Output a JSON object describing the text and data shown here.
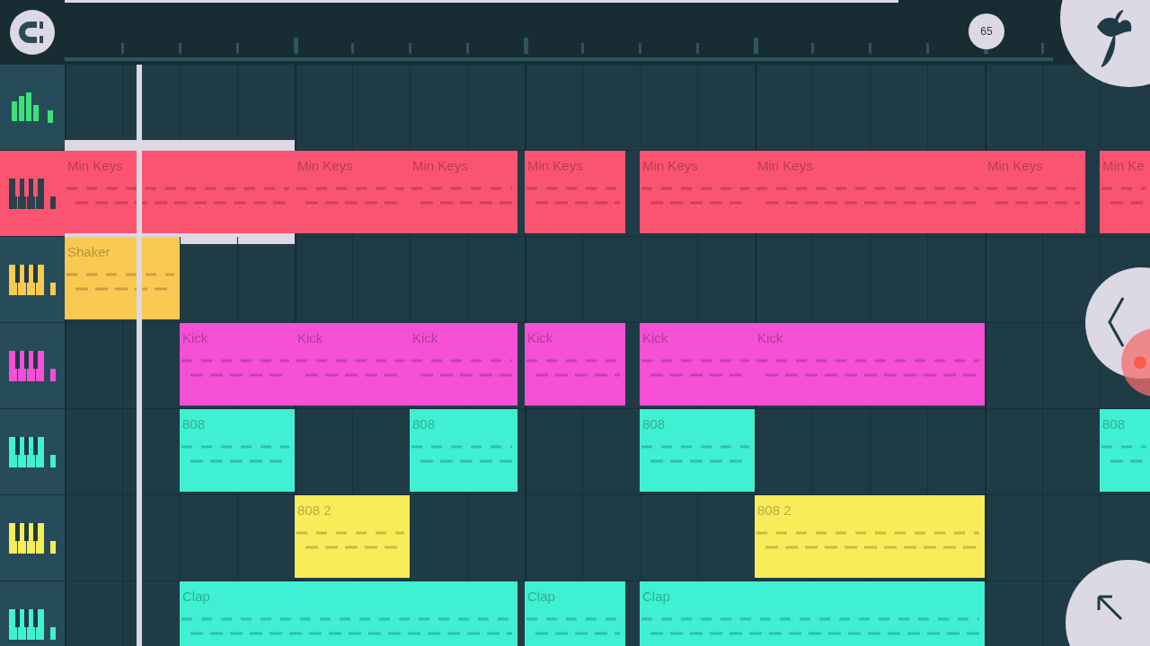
{
  "toolbar": {
    "tempo_badge": "65"
  },
  "tracks": [
    {
      "kind": "master",
      "selected": false,
      "color": "#3ee07a"
    },
    {
      "kind": "instrument",
      "selected": true,
      "color": "#fb5470",
      "clips": [
        {
          "name": "Min Keys",
          "selected": true
        },
        {
          "name": "Min Keys",
          "selected": false
        },
        {
          "name": "Min Keys",
          "selected": false
        },
        {
          "name": "Min Keys",
          "selected": false
        },
        {
          "name": "Min Keys",
          "selected": false
        },
        {
          "name": "Min Keys",
          "selected": false
        },
        {
          "name": "Min Keys",
          "selected": false
        },
        {
          "name": "Min Ke",
          "selected": false
        }
      ]
    },
    {
      "kind": "instrument",
      "selected": false,
      "color": "#f9c952",
      "clips": [
        {
          "name": "Shaker",
          "selected": false
        }
      ]
    },
    {
      "kind": "instrument",
      "selected": false,
      "color": "#f550d6",
      "clips": [
        {
          "name": "Kick",
          "selected": false
        },
        {
          "name": "Kick",
          "selected": false
        },
        {
          "name": "Kick",
          "selected": false
        },
        {
          "name": "Kick",
          "selected": false
        },
        {
          "name": "Kick",
          "selected": false
        },
        {
          "name": "Kick",
          "selected": false
        }
      ]
    },
    {
      "kind": "instrument",
      "selected": false,
      "color": "#3ff0d2",
      "clips": [
        {
          "name": "808",
          "selected": false
        },
        {
          "name": "808",
          "selected": false
        },
        {
          "name": "808",
          "selected": false
        },
        {
          "name": "808",
          "selected": false
        }
      ]
    },
    {
      "kind": "instrument",
      "selected": false,
      "color": "#f8ec58",
      "clips": [
        {
          "name": "808 2",
          "selected": false
        },
        {
          "name": "808 2",
          "selected": false
        }
      ]
    },
    {
      "kind": "instrument",
      "selected": false,
      "color": "#3ff0d2",
      "clips": [
        {
          "name": "Clap",
          "selected": false
        },
        {
          "name": "Clap",
          "selected": false
        },
        {
          "name": "Clap",
          "selected": false
        }
      ]
    }
  ]
}
